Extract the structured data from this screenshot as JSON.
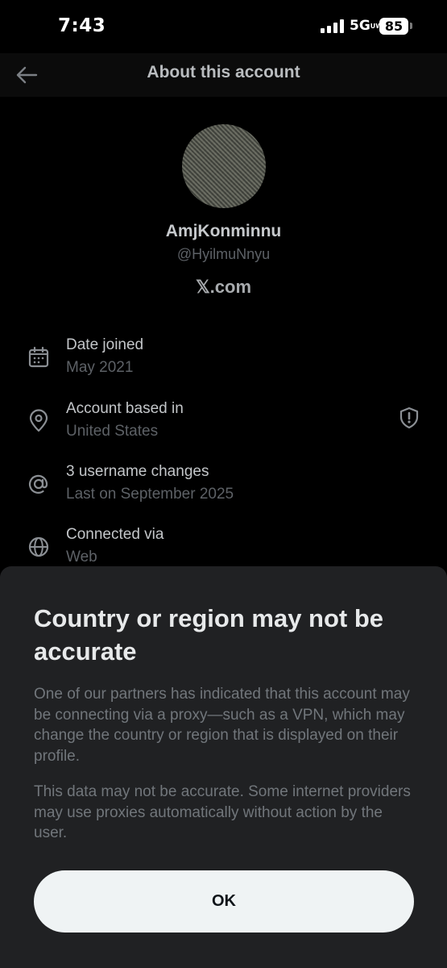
{
  "status_bar": {
    "time": "7:43",
    "network": "5G",
    "network_suffix": "UW",
    "battery": "85"
  },
  "header": {
    "title": "About this account",
    "back_icon": "arrow-left-icon"
  },
  "profile": {
    "display_name": "AmjKonminnu",
    "handle": "@HyilmuNnyu",
    "site": "𝕏.com"
  },
  "details": [
    {
      "icon": "calendar-icon",
      "title": "Date joined",
      "value": "May 2021"
    },
    {
      "icon": "location-pin-icon",
      "title": "Account based in",
      "value": "United States",
      "extra_icon": "shield-alert-icon"
    },
    {
      "icon": "at-sign-icon",
      "title": "3 username changes",
      "value": "Last on September 2025"
    },
    {
      "icon": "globe-icon",
      "title": "Connected via",
      "value": "Web"
    }
  ],
  "sheet": {
    "title": "Country or region may not be accurate",
    "paragraph1": "One of our partners has indicated that this account may be connecting via a proxy—such as a VPN, which may change the country or region that is displayed on their profile.",
    "paragraph2": "This data may not be accurate. Some internet providers may use proxies automatically without action by the user.",
    "ok_label": "OK"
  },
  "colors": {
    "background": "#000000",
    "sheet": "#202123",
    "button": "#eff3f4"
  }
}
